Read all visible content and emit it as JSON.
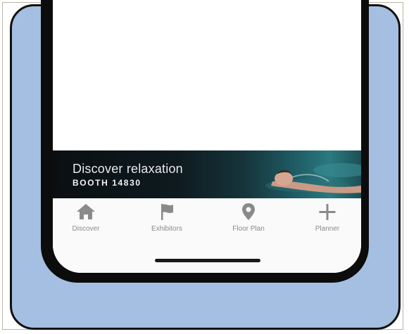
{
  "banner": {
    "title": "Discover relaxation",
    "subtitle": "BOOTH 14830"
  },
  "tabs": [
    {
      "label": "Discover",
      "icon": "home-icon"
    },
    {
      "label": "Exhibitors",
      "icon": "flag-icon"
    },
    {
      "label": "Floor Plan",
      "icon": "map-pin-icon"
    },
    {
      "label": "Planner",
      "icon": "plus-icon"
    }
  ],
  "colors": {
    "background_panel": "#a5bfe2",
    "phone_bezel": "#0c0c0c",
    "tab_icon": "#8a8a8a"
  }
}
